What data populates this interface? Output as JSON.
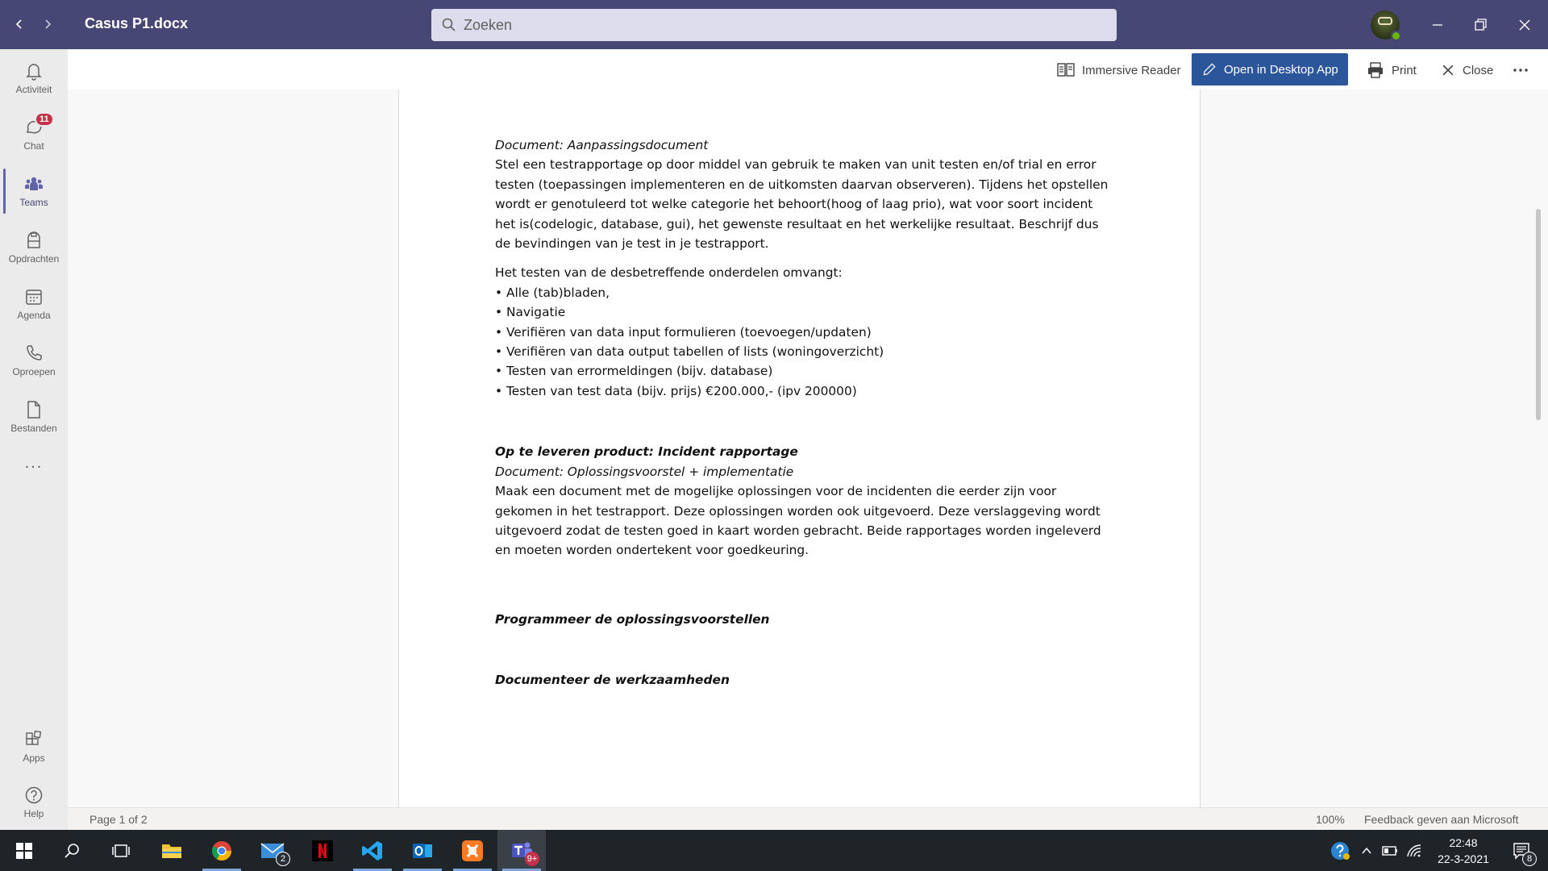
{
  "window": {
    "title": "Casus P1.docx",
    "search_placeholder": "Zoeken"
  },
  "rail": {
    "items": [
      {
        "label": "Activiteit",
        "icon": "bell-icon"
      },
      {
        "label": "Chat",
        "icon": "chat-icon",
        "badge": "11"
      },
      {
        "label": "Teams",
        "icon": "teams-icon"
      },
      {
        "label": "Opdrachten",
        "icon": "assignments-icon"
      },
      {
        "label": "Agenda",
        "icon": "calendar-icon"
      },
      {
        "label": "Oproepen",
        "icon": "phone-icon"
      },
      {
        "label": "Bestanden",
        "icon": "file-icon"
      }
    ],
    "more_label": "...",
    "apps_label": "Apps",
    "help_label": "Help"
  },
  "toolbar": {
    "immersive_reader": "Immersive Reader",
    "open_desktop": "Open in Desktop App",
    "print": "Print",
    "close": "Close"
  },
  "document": {
    "doc1_label": "Document: Aanpassingsdocument",
    "para1": "Stel een testrapportage op door middel van gebruik te maken van unit testen en/of trial en error testen (toepassingen implementeren en de uitkomsten daarvan observeren). Tijdens het opstellen wordt er genotuleerd tot welke categorie het behoort(hoog of laag prio), wat voor soort incident het is(codelogic, database, gui), het gewenste resultaat en het werkelijke resultaat. Beschrijf dus de bevindingen van je test in je testrapport.",
    "list_intro": "Het testen van de desbetreffende onderdelen omvangt:",
    "bullets": [
      "• Alle (tab)bladen,",
      "• Navigatie",
      "• Verifiëren van data input formulieren (toevoegen/updaten)",
      "• Verifiëren van data output tabellen of lists (woningoverzicht)",
      "• Testen van errormeldingen (bijv. database)",
      "• Testen van test data (bijv. prijs) €200.000,- (ipv 200000)"
    ],
    "product_heading": "Op te leveren product: Incident rapportage",
    "doc2_label": "Document: Oplossingsvoorstel + implementatie",
    "para2": "Maak een document met de mogelijke oplossingen voor de incidenten die eerder zijn voor gekomen in het testrapport. Deze oplossingen worden ook uitgevoerd. Deze verslaggeving wordt uitgevoerd zodat de testen goed in kaart worden gebracht. Beide rapportages worden ingeleverd en moeten worden ondertekent voor goedkeuring.",
    "heading_program": "Programmeer de oplossingsvoorstellen",
    "heading_document": "Documenteer de werkzaamheden"
  },
  "statusbar": {
    "page": "Page 1 of 2",
    "zoom": "100%",
    "feedback": "Feedback geven aan Microsoft"
  },
  "taskbar": {
    "mail_badge": "2",
    "teams_badge": "9+",
    "time": "22:48",
    "date": "22-3-2021",
    "notification_count": "8"
  },
  "colors": {
    "titlebar": "#464775",
    "accent": "#6264a7",
    "primary_button": "#2b579a",
    "badge": "#c4314b"
  }
}
